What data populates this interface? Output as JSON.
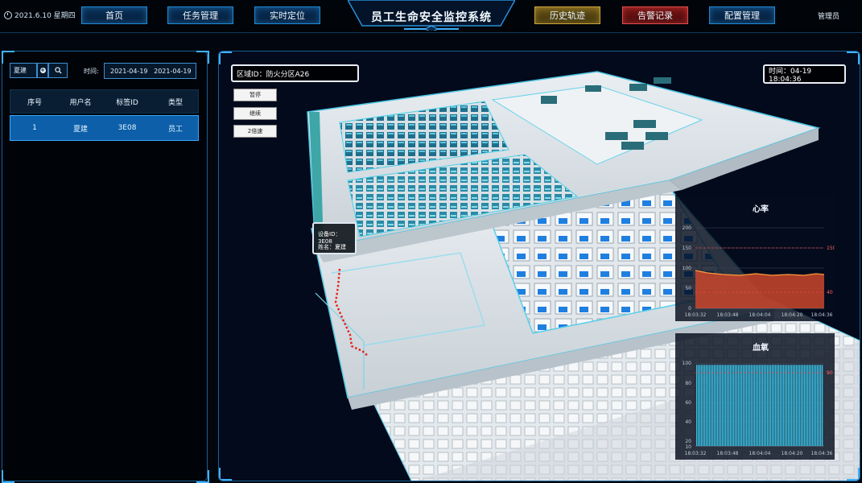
{
  "header": {
    "date": "2021.6.10 星期四",
    "title": "员工生命安全监控系统",
    "user": "管理员",
    "nav": [
      {
        "label": "首页",
        "style": "blue"
      },
      {
        "label": "任务管理",
        "style": "blue"
      },
      {
        "label": "实时定位",
        "style": "blue"
      },
      {
        "label": "历史轨迹",
        "style": "gold"
      },
      {
        "label": "告警记录",
        "style": "red"
      },
      {
        "label": "配置管理",
        "style": "blue"
      }
    ]
  },
  "filter": {
    "person_value": "夏建",
    "time_label": "时间:",
    "date_range": "2021-04-19   2021-04-19"
  },
  "table": {
    "columns": [
      "序号",
      "用户名",
      "标签ID",
      "类型"
    ],
    "rows": [
      {
        "index": "1",
        "user": "夏建",
        "tag": "3E08",
        "type": "员工"
      }
    ]
  },
  "map": {
    "area": "区域ID：防火分区A26",
    "time": "时间：04-19 18:04:36",
    "controls": [
      "暂停",
      "继续",
      "2倍速"
    ],
    "tooltip": {
      "device": "设备ID：3E08",
      "name": "姓名：夏建"
    }
  },
  "heart_chart": {
    "title": "心率",
    "y_ticks": [
      "200",
      "150",
      "100",
      "50",
      "0"
    ],
    "x_ticks": [
      "18:03:32",
      "18:03:48",
      "18:04:04",
      "18:04:20",
      "18:04:36"
    ],
    "upper_threshold": "150",
    "lower_threshold": "40",
    "ylim": [
      0,
      200
    ],
    "approx_level": 85
  },
  "oxygen_chart": {
    "title": "血氧",
    "y_ticks": [
      "100",
      "80",
      "60",
      "40",
      "20",
      "10"
    ],
    "x_ticks": [
      "18:03:32",
      "18:03:48",
      "18:04:04",
      "18:04:20",
      "18:04:36"
    ],
    "threshold": "90",
    "ylim": [
      10,
      100
    ],
    "approx_level": 98
  },
  "colors": {
    "accent": "#1d8ad6",
    "selected_row": "#0c5fa8",
    "alarm": "#e24a4a",
    "history": "#c7a338"
  }
}
